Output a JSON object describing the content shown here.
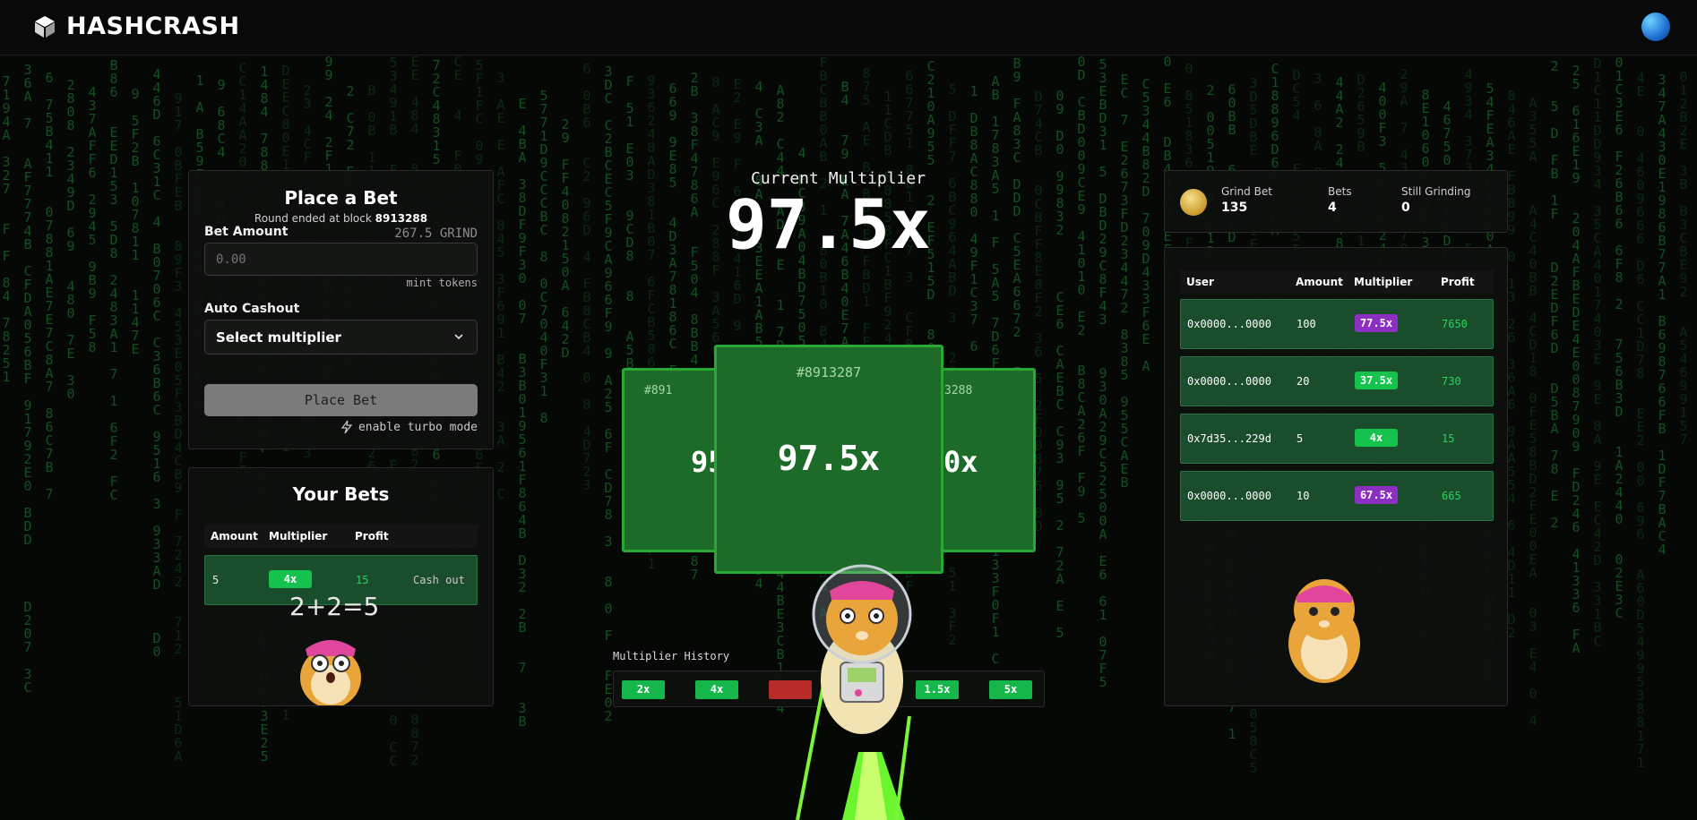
{
  "app": {
    "name": "HASHCRASH"
  },
  "bet": {
    "title": "Place a Bet",
    "round_prefix": "Round ended at block",
    "round_block": "8913288",
    "amount_label": "Bet Amount",
    "balance": "267.5 GRIND",
    "amount_placeholder": "0.00",
    "mint_hint": "mint tokens",
    "auto_label": "Auto Cashout",
    "auto_select": "Select multiplier",
    "place_label": "Place Bet",
    "turbo_label": "enable turbo mode"
  },
  "your_bets": {
    "title": "Your Bets",
    "headers": [
      "Amount",
      "Multiplier",
      "Profit"
    ],
    "row": {
      "amount": "5",
      "multiplier": "4x",
      "profit": "15",
      "action": "Cash out"
    },
    "doodle": "2+2=5"
  },
  "current": {
    "label": "Current Multiplier",
    "value": "97.5x"
  },
  "cards": {
    "left": {
      "block": "#891",
      "mult": "95"
    },
    "main": {
      "block": "#8913287",
      "mult": "97.5x"
    },
    "right": {
      "block": "3288",
      "mult": "0x"
    }
  },
  "history": {
    "label": "Multiplier History",
    "items": [
      {
        "value": "2x",
        "color": "#15b64a"
      },
      {
        "value": "4x",
        "color": "#15b64a"
      },
      {
        "value": "",
        "color": "#b72b2b"
      },
      {
        "value": "",
        "color": "#15b64a"
      },
      {
        "value": "1.5x",
        "color": "#15b64a"
      },
      {
        "value": "5x",
        "color": "#15b64a"
      }
    ]
  },
  "stats": {
    "grind_bet": {
      "label": "Grind Bet",
      "value": "135"
    },
    "bets": {
      "label": "Bets",
      "value": "4"
    },
    "still": {
      "label": "Still Grinding",
      "value": "0"
    }
  },
  "board": {
    "headers": [
      "User",
      "Amount",
      "Multiplier",
      "Profit"
    ],
    "rows": [
      {
        "user": "0x0000...0000",
        "amount": "100",
        "multiplier": "77.5x",
        "profit": "7650",
        "color": "#8d2fc2"
      },
      {
        "user": "0x0000...0000",
        "amount": "20",
        "multiplier": "37.5x",
        "profit": "730",
        "color": "#14c24d"
      },
      {
        "user": "0x7d35...229d",
        "amount": "5",
        "multiplier": "4x",
        "profit": "15",
        "color": "#14c24d"
      },
      {
        "user": "0x0000...0000",
        "amount": "10",
        "multiplier": "67.5x",
        "profit": "665",
        "color": "#8d2fc2"
      }
    ]
  },
  "colors": {
    "accent": "#29a934",
    "profit": "#27d35f",
    "purple": "#8d2fc2"
  },
  "icons": {
    "logo": "cube-icon",
    "select": "chevron-down-icon",
    "turbo": "lightning-icon",
    "coin": "coin-icon"
  }
}
